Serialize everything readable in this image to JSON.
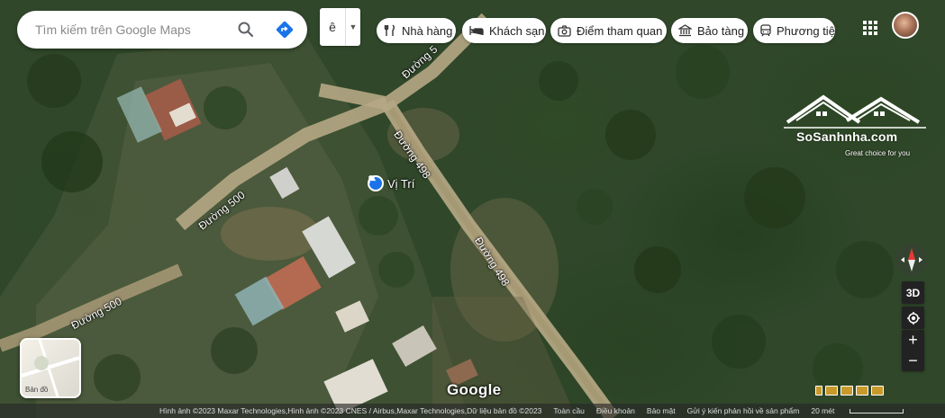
{
  "search": {
    "placeholder": "Tìm kiếm trên Google Maps"
  },
  "dropdown": {
    "value": "ê"
  },
  "chips": [
    {
      "label": "Nhà hàng",
      "icon": "restaurant-icon"
    },
    {
      "label": "Khách sạn",
      "icon": "hotel-icon"
    },
    {
      "label": "Điểm tham quan",
      "icon": "camera-icon"
    },
    {
      "label": "Bảo tàng",
      "icon": "museum-icon"
    },
    {
      "label": "Phương tiện",
      "icon": "transit-icon"
    }
  ],
  "map": {
    "road_labels": [
      {
        "text": "Đường 498"
      },
      {
        "text": "Đường 498"
      },
      {
        "text": "Đường 500"
      },
      {
        "text": "Đường 500"
      },
      {
        "text": "Đường 5"
      }
    ],
    "pin_label": "Vị Trí"
  },
  "watermark": {
    "name": "SoSanhnha.com",
    "tagline": "Great choice for you"
  },
  "controls": {
    "btn_3d": "3D",
    "zoom_in": "+",
    "zoom_out": "−"
  },
  "layer_thumb": {
    "label": "Bản đồ"
  },
  "logo": "Google",
  "footer": {
    "attribution": "Hình ảnh ©2023 Maxar Technologies,Hình ảnh ©2023 CNES / Airbus,Maxar Technologies,Dữ liệu bản đồ ©2023",
    "links": [
      "Toàn cầu",
      "Điều khoản",
      "Bảo mật",
      "Gửi ý kiến phản hồi về sản phẩm"
    ],
    "scale": "20 mét"
  },
  "colors": {
    "accent": "#1a73e8",
    "chip_bg": "#ffffff",
    "vegetation": "#30472a"
  }
}
